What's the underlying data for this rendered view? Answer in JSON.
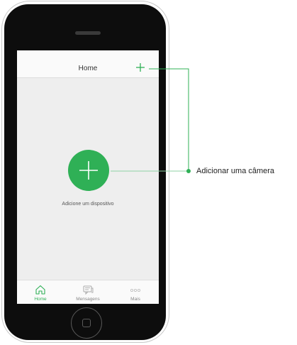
{
  "app": {
    "header_title": "Home",
    "add_device_label": "Adicione um dispositivo"
  },
  "tabs": [
    {
      "label": "Home",
      "icon": "home-icon",
      "active": true
    },
    {
      "label": "Mensagens",
      "icon": "messages-icon",
      "active": false
    },
    {
      "label": "Mais",
      "icon": "more-icon",
      "active": false
    }
  ],
  "callout": {
    "label": "Adicionar uma câmera"
  },
  "colors": {
    "accent": "#2fb056",
    "inactive_tab": "#aaaaaa",
    "screen_bg": "#eeeeee",
    "phone_body": "#0d0d0d"
  }
}
